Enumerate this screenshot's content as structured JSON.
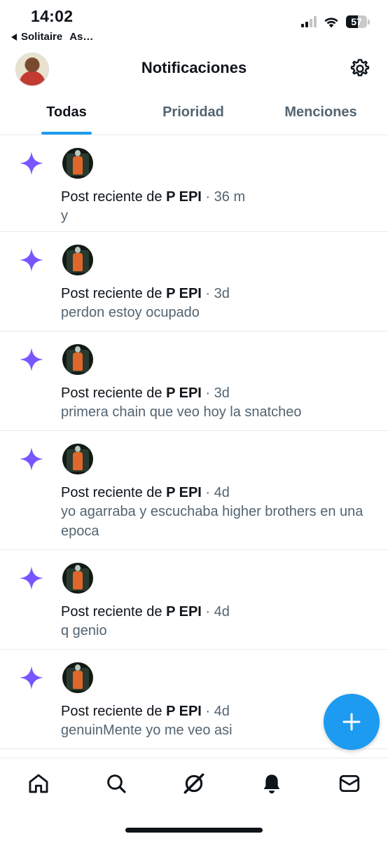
{
  "status_bar": {
    "time": "14:02",
    "back_app": "Solitaire",
    "back_app_extra": "As…",
    "battery_level": "57",
    "signal_bars_active": 2
  },
  "header": {
    "title": "Notificaciones"
  },
  "tabs": [
    {
      "label": "Todas",
      "active": true
    },
    {
      "label": "Prioridad",
      "active": false
    },
    {
      "label": "Menciones",
      "active": false
    }
  ],
  "notifications": [
    {
      "prefix": "Post reciente de ",
      "author": "P EPI",
      "time": " · 36 m",
      "text": "y"
    },
    {
      "prefix": "Post reciente de ",
      "author": "P EPI",
      "time": " · 3d",
      "text": "perdon estoy ocupado"
    },
    {
      "prefix": "Post reciente de ",
      "author": "P EPI",
      "time": " · 3d",
      "text": "primera chain que veo hoy la snatcheo"
    },
    {
      "prefix": "Post reciente de ",
      "author": "P EPI",
      "time": " · 4d",
      "text": "yo agarraba y escuchaba higher brothers en una epoca"
    },
    {
      "prefix": "Post reciente de ",
      "author": "P EPI",
      "time": " · 4d",
      "text": "q genio"
    },
    {
      "prefix": "Post reciente de ",
      "author": "P EPI",
      "time": " · 4d",
      "text": "genuinMente yo me veo asi"
    }
  ],
  "icons": {
    "sparkle": "sparkle-icon",
    "settings": "gear-icon",
    "compose": "plus-icon",
    "nav": [
      "home-icon",
      "search-icon",
      "grok-icon",
      "bell-icon",
      "mail-icon"
    ]
  },
  "colors": {
    "accent": "#1d9bf0",
    "sparkle": "#7856ff",
    "text_primary": "#0f1419",
    "text_secondary": "#536471"
  }
}
